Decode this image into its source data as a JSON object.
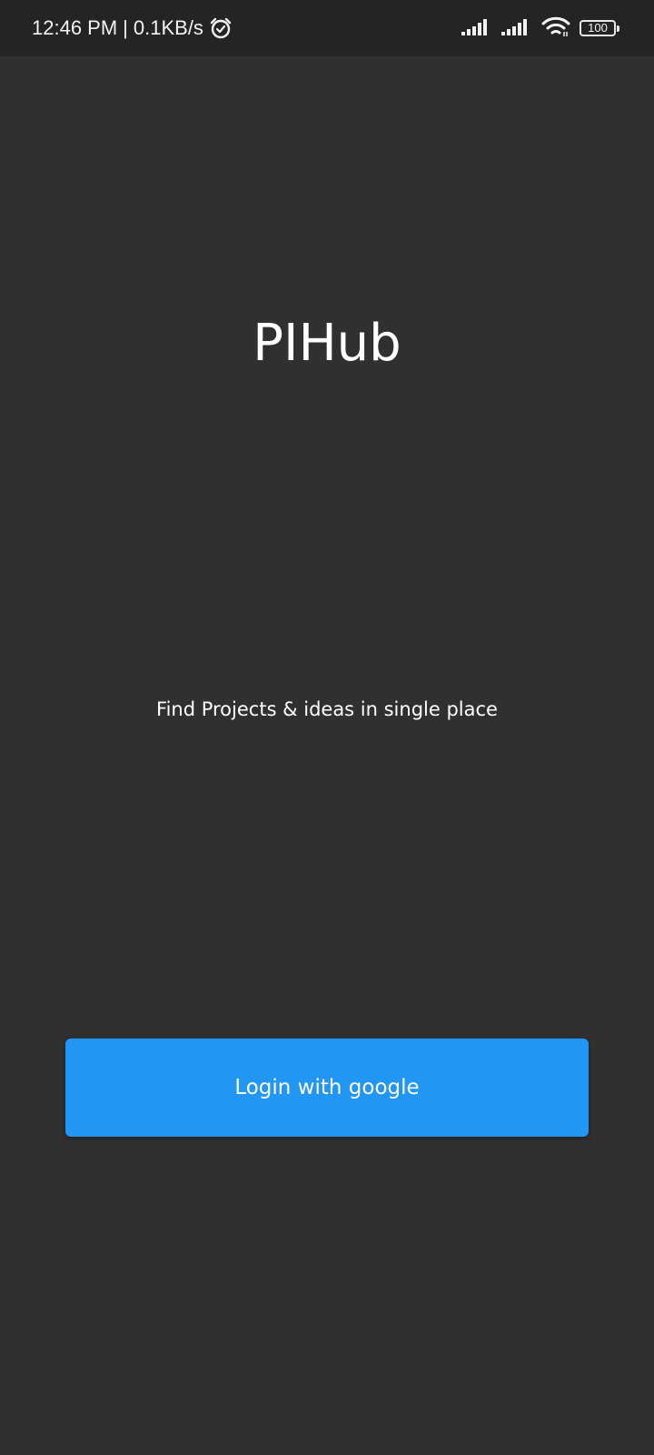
{
  "status_bar": {
    "time": "12:46 PM",
    "separator": "|",
    "network_speed": "0.1KB/s",
    "alarm_icon": "alarm-clock-icon",
    "signal_icons": [
      "signal-strength-icon",
      "signal-strength-icon"
    ],
    "wifi_icon": "wifi-icon",
    "battery_level": "100"
  },
  "app": {
    "title": "PIHub",
    "tagline": "Find Projects & ideas in single place",
    "login_label": "Login with google"
  },
  "colors": {
    "background": "#303030",
    "status_bar_background": "#242424",
    "button": "#2196f3",
    "text": "#ffffff"
  }
}
